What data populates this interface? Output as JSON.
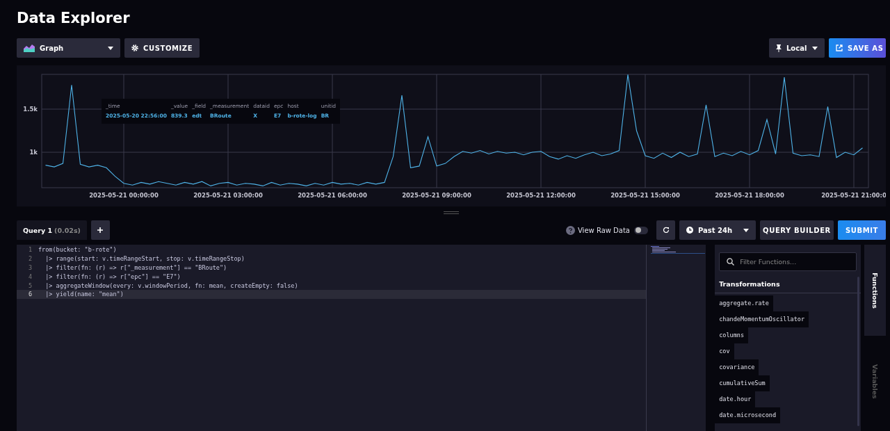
{
  "page": {
    "title": "Data Explorer"
  },
  "toolbar": {
    "view_type": "Graph",
    "customize": "CUSTOMIZE",
    "timezone": "Local",
    "save_as": "SAVE AS"
  },
  "graph": {
    "chart_data": {
      "type": "line",
      "grid": true,
      "ylim": [
        589,
        1903
      ],
      "categories": [
        null,
        null,
        null,
        null,
        null,
        null,
        null,
        null,
        null,
        "2025-05-21 00:00:00",
        null,
        null,
        null,
        null,
        null,
        null,
        null,
        null,
        null,
        null,
        null,
        "2025-05-21 03:00:00",
        null,
        null,
        null,
        null,
        null,
        null,
        null,
        null,
        null,
        null,
        null,
        "2025-05-21 06:00:00",
        null,
        null,
        null,
        null,
        null,
        null,
        null,
        null,
        null,
        null,
        null,
        "2025-05-21 09:00:00",
        null,
        null,
        null,
        null,
        null,
        null,
        null,
        null,
        null,
        null,
        null,
        "2025-05-21 12:00:00",
        null,
        null,
        null,
        null,
        null,
        null,
        null,
        null,
        null,
        null,
        null,
        "2025-05-21 15:00:00",
        null,
        null,
        null,
        null,
        null,
        null,
        null,
        null,
        null,
        null,
        null,
        "2025-05-21 18:00:00",
        null,
        null,
        null,
        null,
        null,
        null,
        null,
        null,
        null,
        null,
        null,
        "2025-05-21 21:00:0",
        null
      ],
      "yticks": [
        {
          "value": 1000,
          "label": "1k"
        },
        {
          "value": 1500,
          "label": "1.5k"
        }
      ],
      "series": [
        {
          "color": "#4fb3e8",
          "values": [
            850,
            830,
            870,
            1780,
            860,
            830,
            850,
            820,
            720,
            640,
            620,
            650,
            630,
            660,
            640,
            620,
            650,
            630,
            660,
            610,
            640,
            650,
            620,
            640,
            630,
            610,
            650,
            620,
            640,
            630,
            610,
            640,
            620,
            650,
            630,
            640,
            620,
            650,
            630,
            650,
            950,
            1660,
            820,
            840,
            1180,
            840,
            870,
            950,
            1010,
            990,
            1020,
            980,
            1010,
            990,
            1000,
            970,
            1000,
            1010,
            950,
            920,
            960,
            930,
            970,
            1000,
            960,
            980,
            1020,
            1900,
            1250,
            960,
            930,
            990,
            940,
            1000,
            950,
            980,
            1550,
            950,
            990,
            960,
            1010,
            970,
            1020,
            1380,
            980,
            1870,
            990,
            960,
            970,
            950,
            1530,
            940,
            1000,
            970,
            1050
          ]
        }
      ]
    },
    "tooltip": {
      "columns": [
        {
          "header": "_time",
          "value": "2025-05-20 22:56:00"
        },
        {
          "header": "_value",
          "value": "839.3"
        },
        {
          "header": "_field",
          "value": "edt"
        },
        {
          "header": "_measurement",
          "value": "BRoute"
        },
        {
          "header": "dataid",
          "value": "X"
        },
        {
          "header": "epc",
          "value": "E7"
        },
        {
          "header": "host",
          "value": "b-rote-log"
        },
        {
          "header": "unitid",
          "value": "BR"
        }
      ]
    }
  },
  "query_tabs": [
    {
      "label": "Query 1",
      "time": "(0.02s)",
      "selected": true
    }
  ],
  "query_controls": {
    "view_raw_data": {
      "label": "View Raw Data",
      "on": false
    },
    "time_range": "Past 24h",
    "query_builder": "QUERY BUILDER",
    "submit": "SUBMIT"
  },
  "editor": {
    "lines": [
      {
        "number": "1",
        "code": "from(bucket: \"b-rote\")",
        "active": false
      },
      {
        "number": "2",
        "code": "  |> range(start: v.timeRangeStart, stop: v.timeRangeStop)",
        "active": false
      },
      {
        "number": "3",
        "code": "  |> filter(fn: (r) => r[\"_measurement\"] == \"BRoute\")",
        "active": false
      },
      {
        "number": "4",
        "code": "  |> filter(fn: (r) => r[\"epc\"] == \"E7\")",
        "active": false
      },
      {
        "number": "5",
        "code": "  |> aggregateWindow(every: v.windowPeriod, fn: mean, createEmpty: false)",
        "active": false
      },
      {
        "number": "6",
        "code": "  |> yield(name: \"mean\")",
        "active": true
      }
    ]
  },
  "functions_panel": {
    "search": {
      "placeholder": "Filter Functions..."
    },
    "section": "Transformations",
    "items": [
      "aggregate.rate",
      "chandeMomentumOscillator",
      "columns",
      "cov",
      "covariance",
      "cumulativeSum",
      "date.hour",
      "date.microsecond"
    ]
  },
  "side_tabs": [
    {
      "label": "Functions",
      "selected": true
    },
    {
      "label": "Variables",
      "selected": false
    }
  ]
}
